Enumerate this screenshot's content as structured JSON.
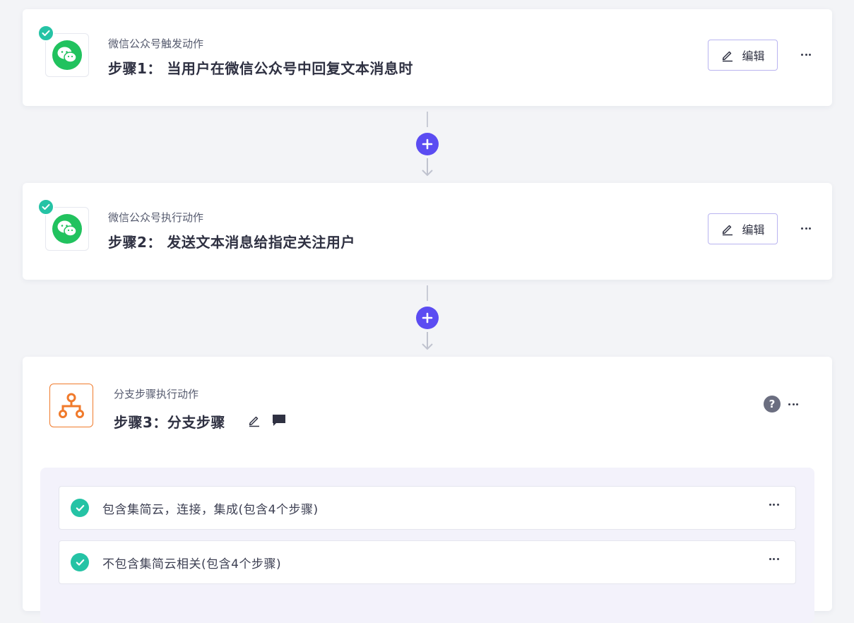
{
  "steps": [
    {
      "subtitle": "微信公众号触发动作",
      "title": "步骤1： 当用户在微信公众号中回复文本消息时",
      "edit_label": "编辑",
      "icon": "wechat-icon",
      "status": "check-icon"
    },
    {
      "subtitle": "微信公众号执行动作",
      "title": "步骤2： 发送文本消息给指定关注用户",
      "edit_label": "编辑",
      "icon": "wechat-icon",
      "status": "check-icon"
    },
    {
      "subtitle": "分支步骤执行动作",
      "title": "步骤3：分支步骤",
      "icon": "branch-icon",
      "help_label": "?",
      "branches": [
        {
          "label": "包含集简云，连接，集成(包含4个步骤)",
          "status": "check-icon"
        },
        {
          "label": "不包含集简云相关(包含4个步骤)",
          "status": "check-icon"
        }
      ]
    }
  ],
  "colors": {
    "accent": "#5b4cf2",
    "success": "#25c3a5",
    "wechat": "#21c25e",
    "branch": "#f07a2b",
    "edit_border": "#b9b4f0"
  }
}
